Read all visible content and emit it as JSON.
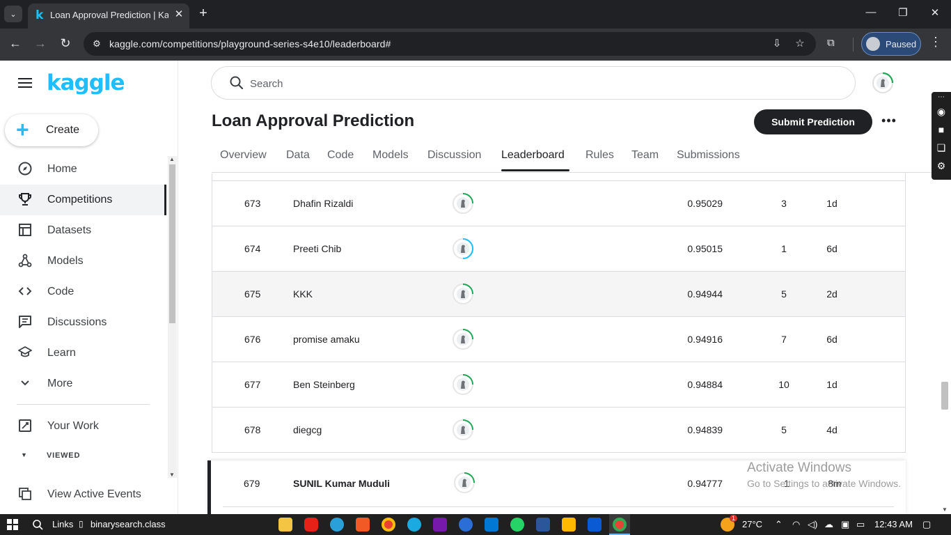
{
  "browser": {
    "tab_title": "Loan Approval Prediction | Kaggle",
    "tab_favicon": "k",
    "url": "kaggle.com/competitions/playground-series-s4e10/leaderboard#",
    "profile_label": "Paused"
  },
  "sidebar": {
    "logo": "kaggle",
    "create_label": "Create",
    "items": [
      {
        "label": "Home",
        "icon": "compass-icon"
      },
      {
        "label": "Competitions",
        "icon": "trophy-icon"
      },
      {
        "label": "Datasets",
        "icon": "table-icon"
      },
      {
        "label": "Models",
        "icon": "models-icon"
      },
      {
        "label": "Code",
        "icon": "code-icon"
      },
      {
        "label": "Discussions",
        "icon": "discussions-icon"
      },
      {
        "label": "Learn",
        "icon": "learn-icon"
      },
      {
        "label": "More",
        "icon": "chevron-down-icon"
      }
    ],
    "your_work": "Your Work",
    "viewed_label": "VIEWED",
    "view_active_events": "View Active Events",
    "active_item": "Competitions"
  },
  "search": {
    "placeholder": "Search"
  },
  "competition": {
    "title": "Loan Approval Prediction",
    "submit_label": "Submit Prediction",
    "tabs": [
      "Overview",
      "Data",
      "Code",
      "Models",
      "Discussion",
      "Leaderboard",
      "Rules",
      "Team",
      "Submissions"
    ],
    "active_tab": "Leaderboard"
  },
  "leaderboard": {
    "rows": [
      {
        "rank": "673",
        "team": "Dhafin Rizaldi",
        "score": "0.95029",
        "entries": "3",
        "last": "1d"
      },
      {
        "rank": "674",
        "team": "Preeti Chib",
        "score": "0.95015",
        "entries": "1",
        "last": "6d"
      },
      {
        "rank": "675",
        "team": "KKK",
        "score": "0.94944",
        "entries": "5",
        "last": "2d"
      },
      {
        "rank": "676",
        "team": "promise amaku",
        "score": "0.94916",
        "entries": "7",
        "last": "6d"
      },
      {
        "rank": "677",
        "team": "Ben Steinberg",
        "score": "0.94884",
        "entries": "10",
        "last": "1d"
      },
      {
        "rank": "678",
        "team": "diegcg",
        "score": "0.94839",
        "entries": "5",
        "last": "4d"
      }
    ],
    "pinned": {
      "rank": "679",
      "team": "SUNIL Kumar Muduli",
      "score": "0.94777",
      "entries": "1",
      "last": "8m"
    }
  },
  "watermark": {
    "line1": "Activate Windows",
    "line2": "Go to Settings to activate Windows."
  },
  "taskbar": {
    "links_label": "Links",
    "file_label": "binarysearch.class",
    "weather": "27°C",
    "time": "12:43 AM",
    "weather_badge": "1"
  },
  "colors": {
    "kaggle_blue": "#20beff",
    "dark": "#202124",
    "progress_green": "#20a657"
  }
}
